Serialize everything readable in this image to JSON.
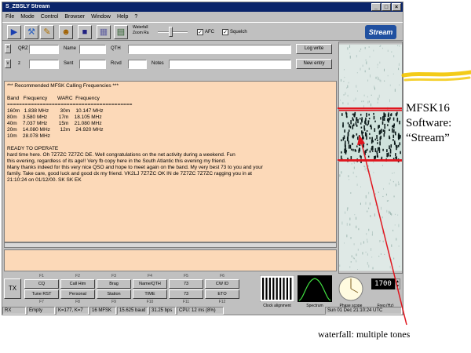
{
  "window": {
    "title": "S_ZBSLY Stream",
    "buttons": [
      "_",
      "□",
      "×"
    ]
  },
  "menu": [
    "File",
    "Mode",
    "Control",
    "Browser",
    "Window",
    "Help",
    "?"
  ],
  "toolbar": {
    "slider_label": "Waterfall Zoom Ra",
    "afc_label": "AFC",
    "squelch_label": "Squelch",
    "logo": "Stream"
  },
  "log": {
    "qrz_label": "QRZ",
    "name_label": "Name",
    "qth_label": "QTH",
    "sent_label": "Sent",
    "rcvd_label": "Rcvd",
    "notes_label": "Notes",
    "log_button": "Log write",
    "new_button": "New entry"
  },
  "rx": {
    "lines": [
      "*** Recommended MFSK Calling Frequencies ***",
      "",
      "Band   Frequency       WARC  Frequency",
      "==========================================",
      "160m   1.838 MHz        30m    10.147 MHz",
      "80m    3.580 MHz        17m    18.105 MHz",
      "40m    7.037 MHz        15m    21.080 MHz",
      "20m    14.080 MHz       12m    24.920 MHz",
      "10m    28.078 MHz",
      "",
      "READY TO OPERATE",
      "hard time here. Oh 7Z7ZC 7Z7ZC DE. Well congratulations on the net activity during a weekend. Fun",
      "this evening, regardless of its age!! Very fb copy here in the South Atlantic this evening my friend.",
      "Many thanks indeed for this very nice QSO and hope to meet again on the band. My very best 73 to you and your",
      "family. Take care, good luck and good dx my friend. VK2LJ 7Z7ZC OK IN de 7Z7ZC 7Z7ZC ragging you in at",
      "21:10:24 on 01/12/00. SK SK EK"
    ]
  },
  "macros": {
    "tx_label": "TX",
    "f_top": [
      "F1",
      "F2",
      "F3",
      "F4",
      "F5",
      "F6"
    ],
    "top": [
      "CQ",
      "Call Him",
      "Brag",
      "Name/QTH",
      "73",
      "CW ID"
    ],
    "bottom": [
      "Tune RST",
      "Personal",
      "Station",
      "TIME",
      "73",
      "ETO"
    ],
    "f_bottom": [
      "F7",
      "F8",
      "F9",
      "F10",
      "F11",
      "F12"
    ]
  },
  "instruments": {
    "clock_label": "Clock alignment",
    "spectrum_label": "Spectrum",
    "phase_label": "Phase scope",
    "freq_label": "Freq (Hz)",
    "freq_value": "1700"
  },
  "status": {
    "mode": "RX",
    "buffer": "Empty",
    "kparams": "K=177, K=7",
    "modem": "16 MFSK",
    "bandwidth": "15.625 baud",
    "rate": "31.25 bps",
    "cpu": "CPU: 12 ms (8%)",
    "time": "Sun 01 Dec 21:10:24 UTC"
  },
  "annotations": {
    "side_lines": [
      "MFSK16",
      "Software:",
      "“Stream”"
    ],
    "bottom": "waterfall: multiple tones"
  },
  "colors": {
    "titlebar": "#0a246a",
    "text_bg": "#fcd9b8",
    "marker_red": "#e0151e",
    "highlight_yellow": "#f2c500"
  }
}
